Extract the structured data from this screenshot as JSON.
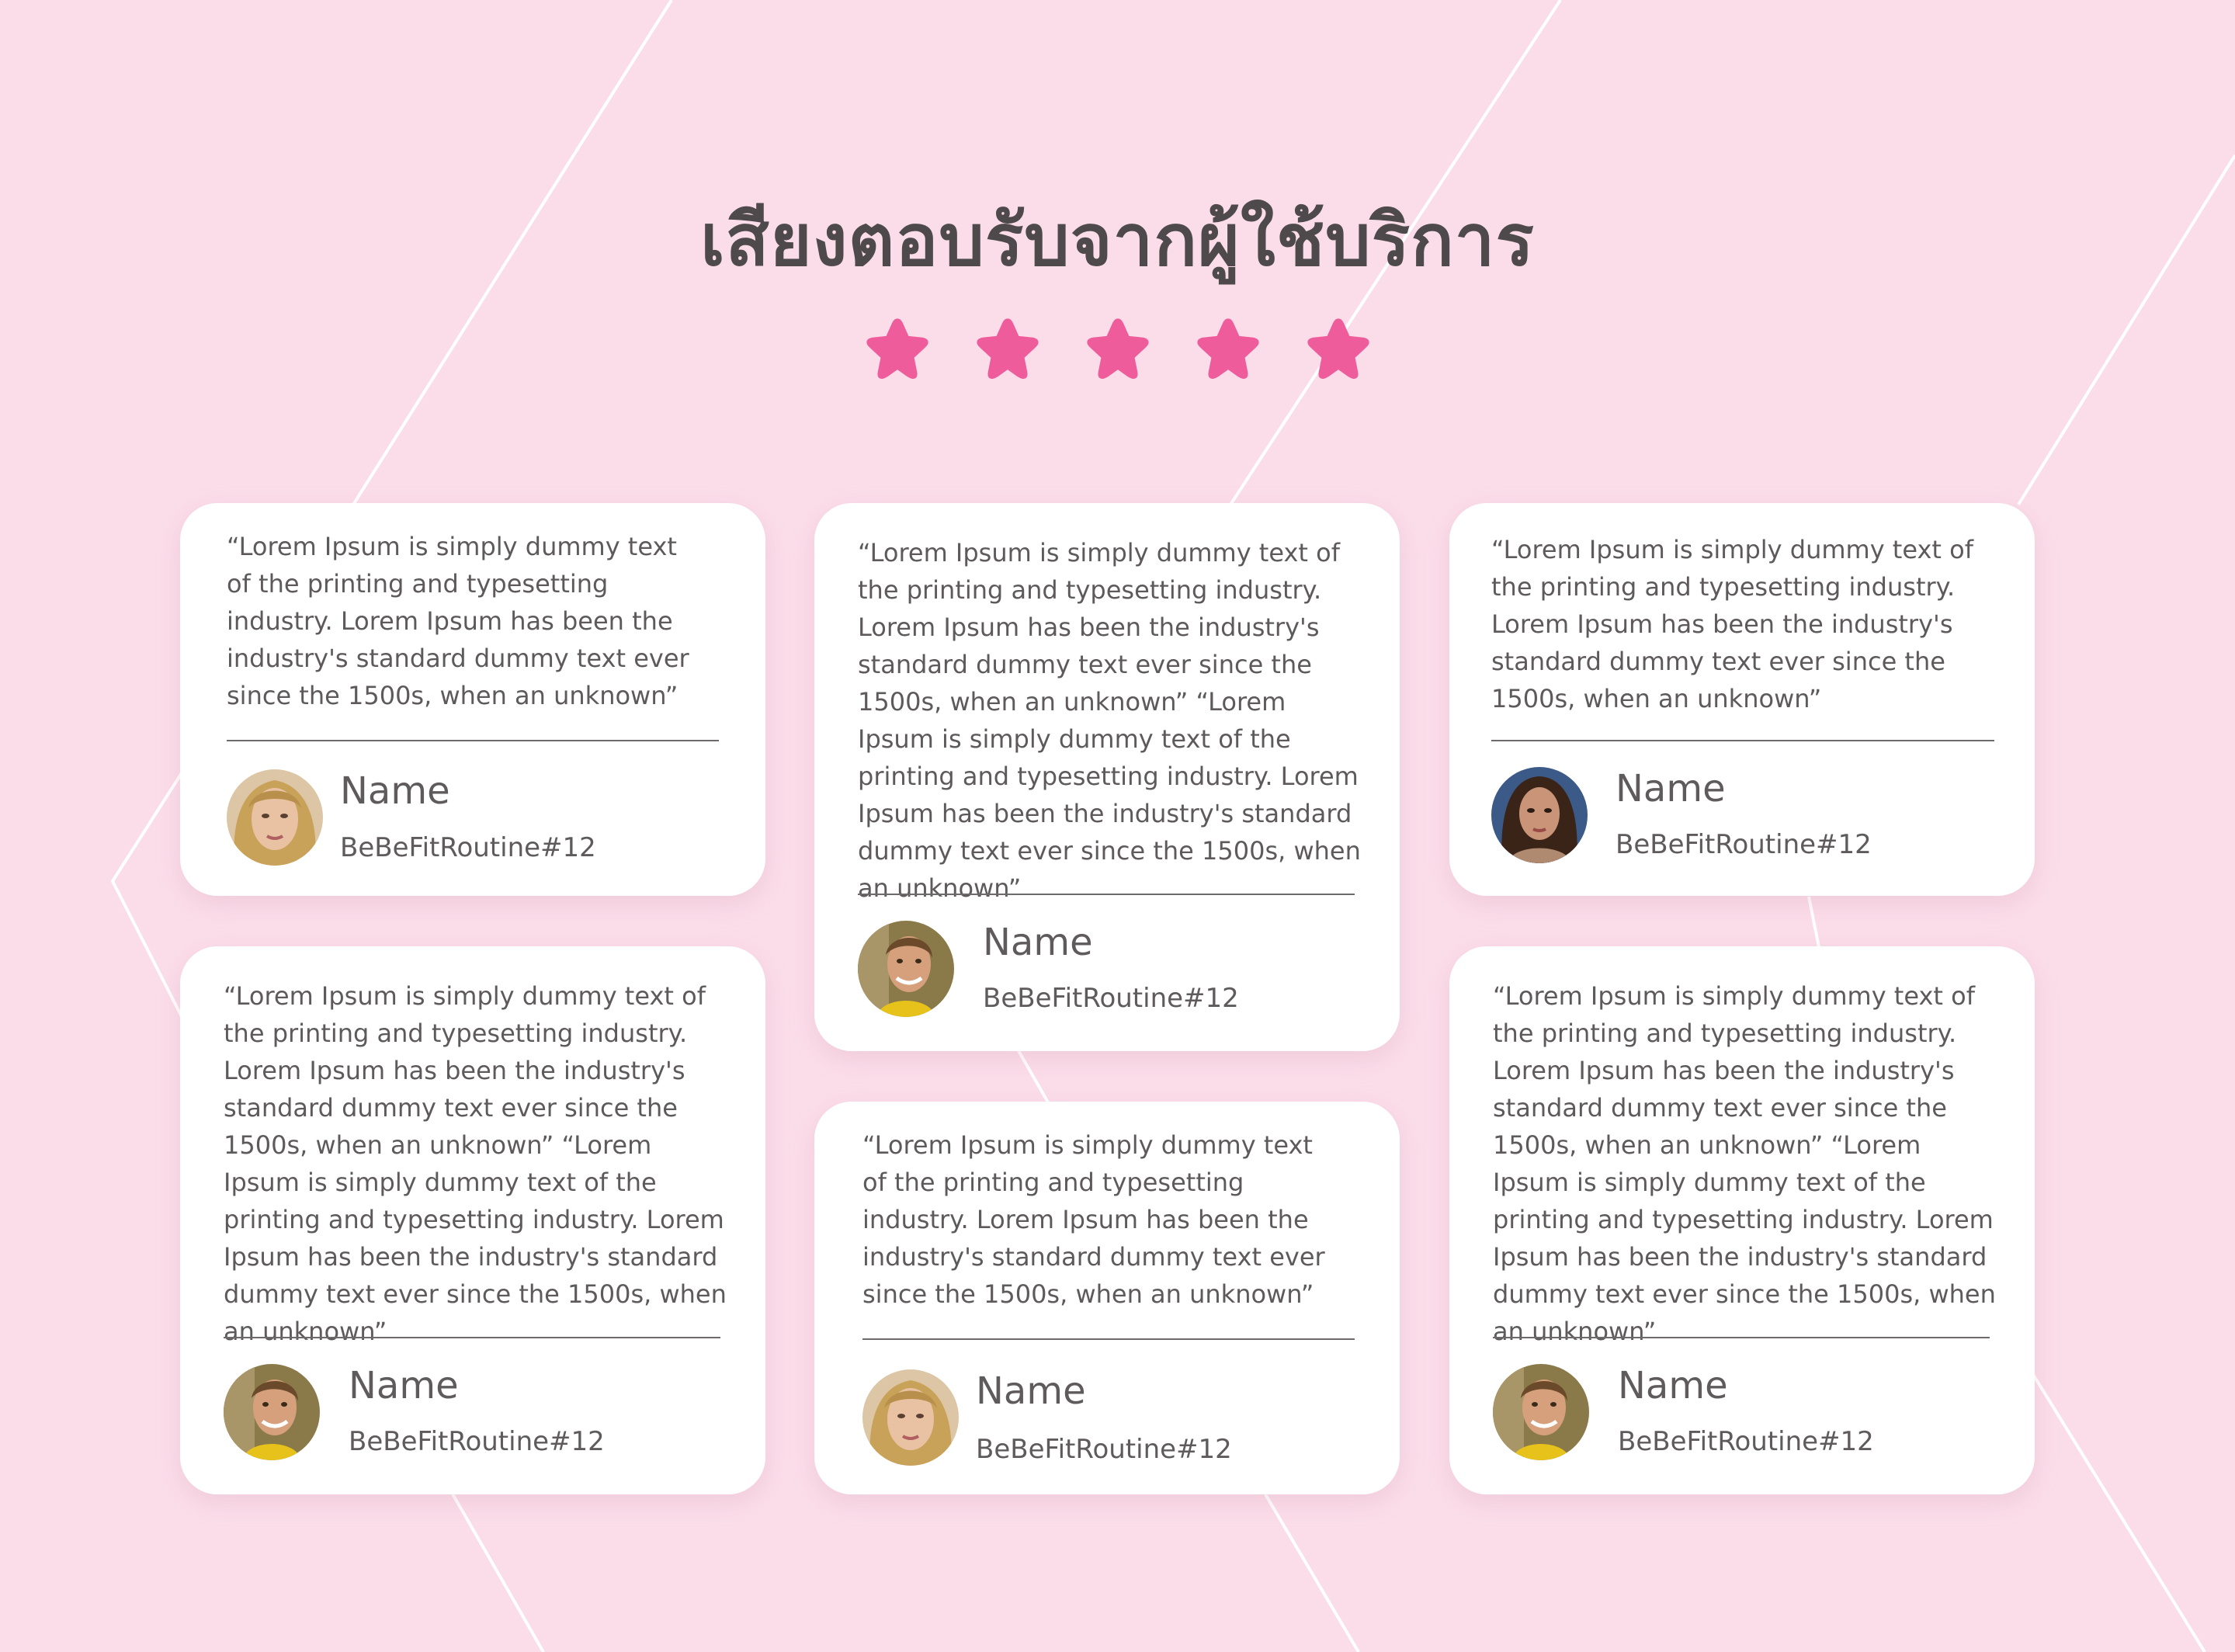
{
  "header": {
    "title": "เสียงตอบรับจากผู้ใช้บริการ",
    "rating": 5,
    "star_color": "#ee5c9b"
  },
  "colors": {
    "background": "#fbdde9",
    "card": "#ffffff",
    "text": "#5e5a5c",
    "title": "#4e4a4c"
  },
  "testimonials": [
    {
      "quote": "“Lorem Ipsum is simply dummy text of the printing and typesetting industry. Lorem Ipsum has been the industry's standard dummy text ever since the 1500s, when an unknown”",
      "name": "Name",
      "handle": "BeBeFitRoutine#12",
      "avatar": "avatar-blonde"
    },
    {
      "quote": "“Lorem Ipsum is simply dummy text of the printing and typesetting industry. Lorem Ipsum has been the industry's standard dummy text ever since the 1500s, when an unknown” “Lorem Ipsum is simply dummy text of the printing and typesetting industry. Lorem Ipsum has been the industry's standard dummy text ever since the 1500s, when an unknown”",
      "name": "Name",
      "handle": "BeBeFitRoutine#12",
      "avatar": "avatar-yellow-scarf"
    },
    {
      "quote": "“Lorem Ipsum is simply dummy text of the printing and typesetting industry. Lorem Ipsum has been the industry's standard dummy text ever since the 1500s, when an unknown”",
      "name": "Name",
      "handle": "BeBeFitRoutine#12",
      "avatar": "avatar-brunette"
    },
    {
      "quote": "“Lorem Ipsum is simply dummy text of the printing and typesetting industry. Lorem Ipsum has been the industry's standard dummy text ever since the 1500s, when an unknown” “Lorem Ipsum is simply dummy text of the printing and typesetting industry. Lorem Ipsum has been the industry's standard dummy text ever since the 1500s, when an unknown”",
      "name": "Name",
      "handle": "BeBeFitRoutine#12",
      "avatar": "avatar-yellow-scarf"
    },
    {
      "quote": "“Lorem Ipsum is simply dummy text of the printing and typesetting industry. Lorem Ipsum has been the industry's standard dummy text ever since the 1500s, when an unknown”",
      "name": "Name",
      "handle": "BeBeFitRoutine#12",
      "avatar": "avatar-blonde"
    },
    {
      "quote": "“Lorem Ipsum is simply dummy text of the printing and typesetting industry. Lorem Ipsum has been the industry's standard dummy text ever since the 1500s, when an unknown” “Lorem Ipsum is simply dummy text of the printing and typesetting industry. Lorem Ipsum has been the industry's standard dummy text ever since the 1500s, when an unknown”",
      "name": "Name",
      "handle": "BeBeFitRoutine#12",
      "avatar": "avatar-yellow-scarf"
    }
  ]
}
